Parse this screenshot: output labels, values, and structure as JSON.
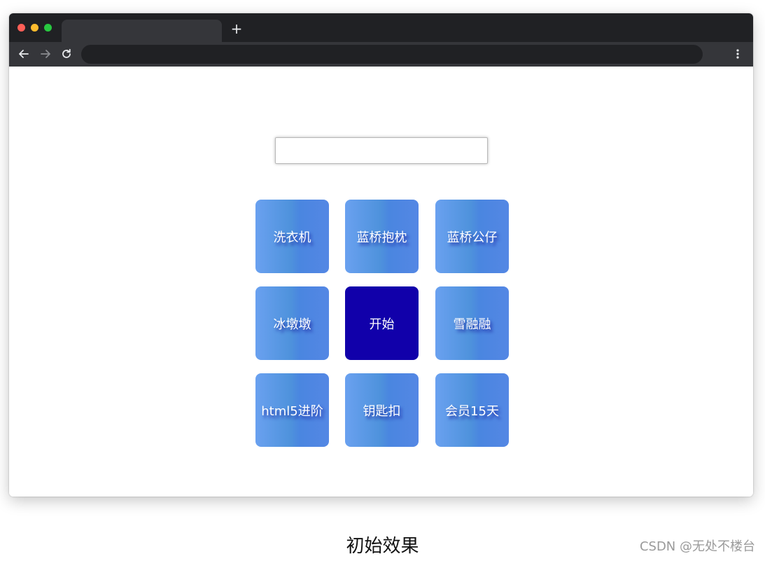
{
  "browser": {
    "new_tab_symbol": "+",
    "back_icon": "arrow-left-icon",
    "forward_icon": "arrow-right-icon",
    "reload_icon": "reload-icon",
    "menu_icon": "kebab-menu-icon"
  },
  "page": {
    "result_input": {
      "value": ""
    },
    "grid": {
      "cells": [
        {
          "label": "洗衣机"
        },
        {
          "label": "蓝桥抱枕"
        },
        {
          "label": "蓝桥公仔"
        },
        {
          "label": "冰墩墩"
        },
        {
          "label": "开始"
        },
        {
          "label": "雪融融"
        },
        {
          "label": "html5进阶"
        },
        {
          "label": "钥匙扣"
        },
        {
          "label": "会员15天"
        }
      ]
    },
    "colors": {
      "cell_gradient_start": "#6aa1f0",
      "cell_gradient_end": "#5487e4",
      "start_button": "#1100aa"
    }
  },
  "caption": "初始效果",
  "watermark": "CSDN @无处不楼台"
}
